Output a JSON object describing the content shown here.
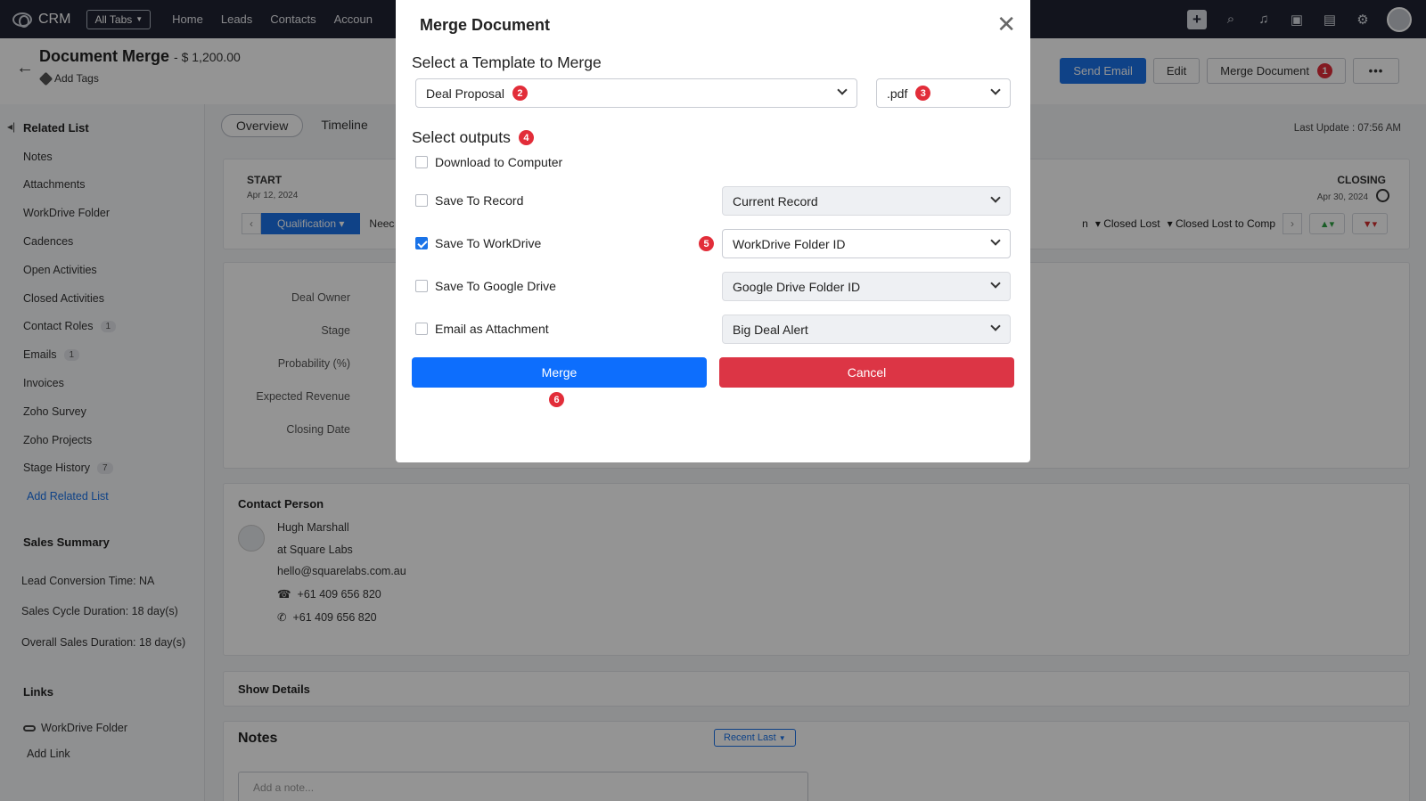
{
  "topbar": {
    "brand": "CRM",
    "all_tabs": "All Tabs",
    "nav": [
      "Home",
      "Leads",
      "Contacts",
      "Accoun"
    ]
  },
  "record": {
    "title": "Document Merge",
    "amount": "- $ 1,200.00",
    "add_tags": "Add Tags",
    "buttons": {
      "send_email": "Send Email",
      "edit": "Edit",
      "merge_document": "Merge Document",
      "more": "•••"
    },
    "merge_badge": "1"
  },
  "sidebar": {
    "related_list_title": "Related List",
    "items": [
      {
        "label": "Notes",
        "count": ""
      },
      {
        "label": "Attachments",
        "count": ""
      },
      {
        "label": "WorkDrive Folder",
        "count": ""
      },
      {
        "label": "Cadences",
        "count": ""
      },
      {
        "label": "Open Activities",
        "count": ""
      },
      {
        "label": "Closed Activities",
        "count": ""
      },
      {
        "label": "Contact Roles",
        "count": "1"
      },
      {
        "label": "Emails",
        "count": "1"
      },
      {
        "label": "Invoices",
        "count": ""
      },
      {
        "label": "Zoho Survey",
        "count": ""
      },
      {
        "label": "Zoho Projects",
        "count": ""
      },
      {
        "label": "Stage History",
        "count": "7"
      }
    ],
    "add_related_list": "Add Related List",
    "sales_summary_title": "Sales Summary",
    "sales_summary": [
      "Lead Conversion Time: NA",
      "Sales Cycle Duration: 18 day(s)",
      "Overall Sales Duration: 18 day(s)"
    ],
    "links_title": "Links",
    "link_workdrive": "WorkDrive Folder",
    "add_link": "Add Link"
  },
  "main": {
    "tabs": [
      "Overview",
      "Timeline"
    ],
    "last_update": "Last Update : 07:56 AM",
    "stage": {
      "start_label": "START",
      "start_date": "Apr 12, 2024",
      "closing_label": "CLOSING",
      "closing_date": "Apr 30, 2024",
      "active_stage": "Qualification",
      "next_stage": "Neec",
      "right_partial": "n",
      "closed_lost": "Closed Lost",
      "closed_lost_comp": "Closed Lost to Comp"
    },
    "fields": [
      "Deal Owner",
      "Stage",
      "Probability (%)",
      "Expected Revenue",
      "Closing Date"
    ],
    "contact": {
      "title": "Contact Person",
      "name": "Hugh Marshall",
      "company": "at Square Labs",
      "email": "hello@squarelabs.com.au",
      "phone1": "+61 409 656 820",
      "phone2": "+61 409 656 820"
    },
    "show_details": "Show Details",
    "notes": {
      "title": "Notes",
      "sort": "Recent Last",
      "placeholder": "Add a note..."
    }
  },
  "modal": {
    "title": "Merge Document",
    "template_heading": "Select a Template to Merge",
    "template_value": "Deal Proposal",
    "template_badge": "2",
    "format_value": ".pdf",
    "format_badge": "3",
    "outputs_heading": "Select outputs",
    "outputs_badge": "4",
    "options": [
      {
        "label": "Download to Computer",
        "checked": false,
        "select": ""
      },
      {
        "label": "Save To Record",
        "checked": false,
        "select": "Current Record"
      },
      {
        "label": "Save To WorkDrive",
        "checked": true,
        "select": "WorkDrive Folder ID"
      },
      {
        "label": "Save To Google Drive",
        "checked": false,
        "select": "Google Drive Folder ID"
      },
      {
        "label": "Email as Attachment",
        "checked": false,
        "select": "Big Deal Alert"
      }
    ],
    "workdrive_badge": "5",
    "merge_label": "Merge",
    "merge_badge": "6",
    "cancel_label": "Cancel"
  }
}
